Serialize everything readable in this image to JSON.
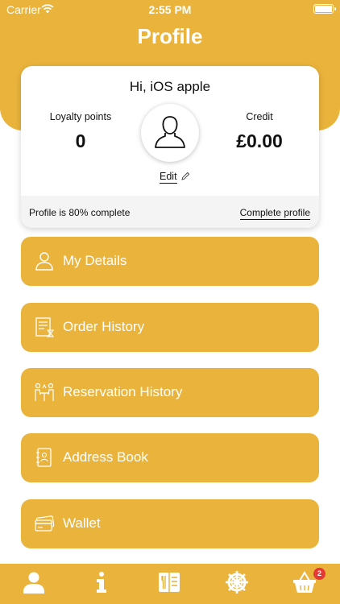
{
  "status_bar": {
    "carrier": "Carrier",
    "time": "2:55 PM"
  },
  "header": {
    "title": "Profile"
  },
  "profile_card": {
    "greeting": "Hi, iOS apple",
    "loyalty_label": "Loyalty points",
    "loyalty_value": "0",
    "credit_label": "Credit",
    "credit_value": "£0.00",
    "edit_label": "Edit",
    "progress_text": "Profile is 80% complete",
    "complete_link": "Complete profile"
  },
  "menu": {
    "items": [
      {
        "label": "My Details",
        "icon": "user-icon"
      },
      {
        "label": "Order History",
        "icon": "receipt-icon"
      },
      {
        "label": "Reservation History",
        "icon": "table-reservation-icon"
      },
      {
        "label": "Address Book",
        "icon": "address-book-icon"
      },
      {
        "label": "Wallet",
        "icon": "credit-card-icon"
      }
    ]
  },
  "tab_bar": {
    "tabs": [
      {
        "icon": "profile-tab-icon",
        "active": true
      },
      {
        "icon": "info-tab-icon",
        "active": false
      },
      {
        "icon": "menu-tab-icon",
        "active": false
      },
      {
        "icon": "settings-tab-icon",
        "active": false
      },
      {
        "icon": "basket-tab-icon",
        "active": false
      }
    ],
    "cart_badge": "2"
  },
  "colors": {
    "brand": "#EAB43C",
    "badge": "#E53935",
    "card_footer": "#F4F4F4"
  }
}
